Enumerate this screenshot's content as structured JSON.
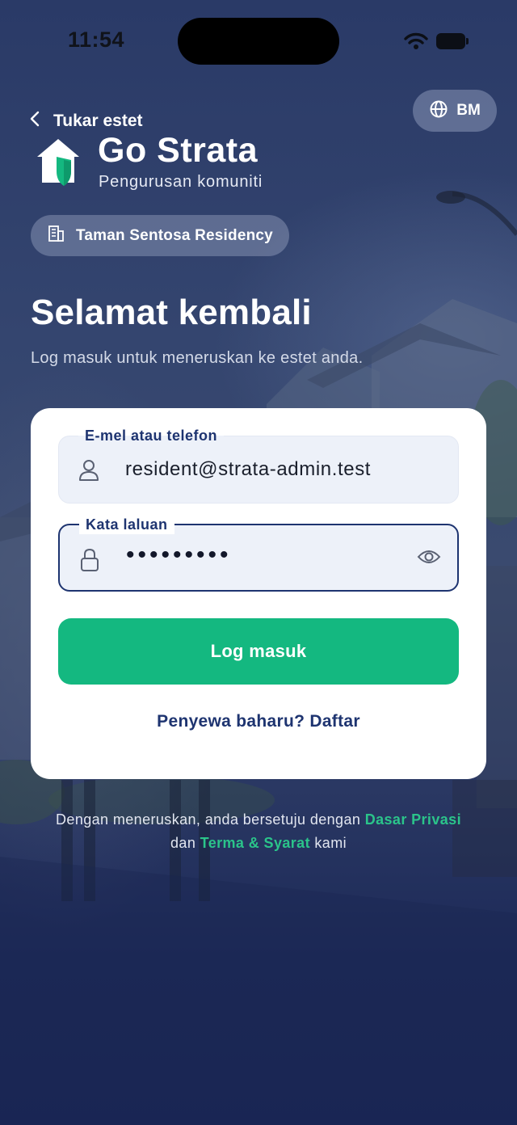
{
  "status_bar": {
    "time": "11:54"
  },
  "header": {
    "back_label": "Tukar estet",
    "language_label": "BM",
    "app_name": "Go Strata",
    "app_tagline": "Pengurusan komuniti",
    "estate_name": "Taman Sentosa Residency"
  },
  "welcome": {
    "title": "Selamat kembali",
    "subtitle": "Log masuk untuk meneruskan ke estet anda."
  },
  "form": {
    "email_label": "E-mel atau telefon",
    "email_value": "resident@strata-admin.test",
    "password_label": "Kata laluan",
    "password_mask": "•••••••••",
    "login_button": "Log masuk",
    "register_link": "Penyewa baharu? Daftar"
  },
  "footer": {
    "prefix": "Dengan meneruskan, anda bersetuju dengan",
    "privacy_link": "Dasar Privasi",
    "joiner": "dan",
    "terms_link": "Terma & Syarat",
    "suffix": "kami"
  },
  "colors": {
    "accent_green": "#14b880",
    "navy": "#1e3470",
    "background": "#2a3a67"
  },
  "icons": [
    "chevron-left-icon",
    "globe-icon",
    "house-shield-logo",
    "building-icon",
    "user-icon",
    "lock-icon",
    "eye-icon",
    "wifi-icon",
    "battery-icon"
  ]
}
